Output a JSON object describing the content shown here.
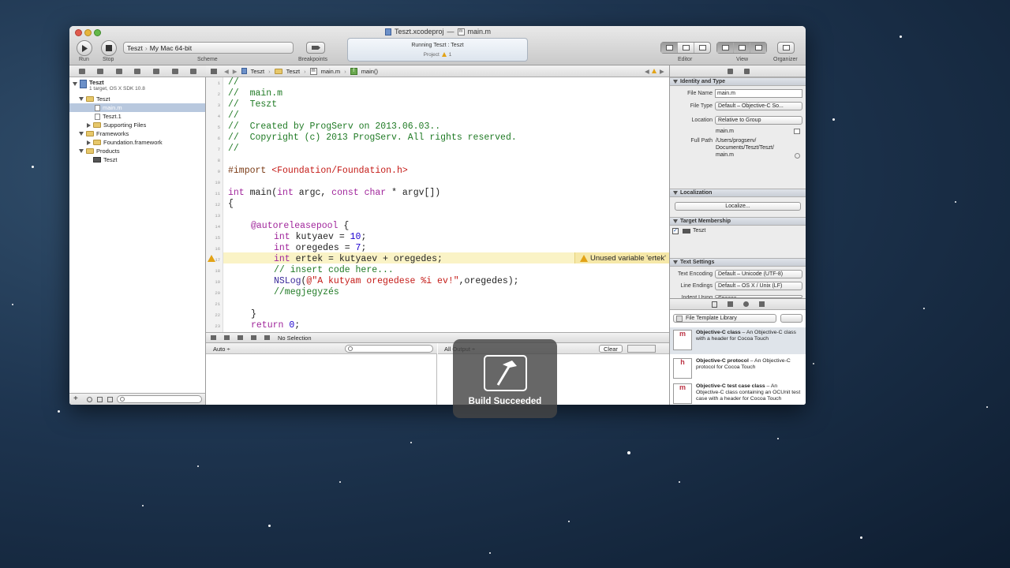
{
  "window": {
    "title_project": "Teszt.xcodeproj",
    "title_sep": "—",
    "title_file": "main.m"
  },
  "toolbar": {
    "run_label": "Run",
    "stop_label": "Stop",
    "scheme_target": "Teszt",
    "scheme_sep": "›",
    "scheme_dest": "My Mac 64-bit",
    "scheme_label": "Scheme",
    "breakpoints_label": "Breakpoints",
    "activity_status": "Running Teszt : Teszt",
    "activity_project_label": "Project",
    "activity_warning_count": "1",
    "editor_label": "Editor",
    "view_label": "View",
    "organizer_label": "Organizer"
  },
  "navigator": {
    "project_name": "Teszt",
    "project_sub": "1 target, OS X SDK 10.8",
    "items": [
      {
        "label": "Teszt",
        "kind": "folder"
      },
      {
        "label": "main.m",
        "kind": "file"
      },
      {
        "label": "Teszt.1",
        "kind": "file"
      },
      {
        "label": "Supporting Files",
        "kind": "folder"
      },
      {
        "label": "Frameworks",
        "kind": "folder"
      },
      {
        "label": "Foundation.framework",
        "kind": "folder"
      },
      {
        "label": "Products",
        "kind": "folder"
      },
      {
        "label": "Teszt",
        "kind": "product"
      }
    ]
  },
  "jumpbar": {
    "crumbs": [
      "Teszt",
      "Teszt",
      "main.m",
      "main()"
    ]
  },
  "editor": {
    "line_numbers": [
      "1",
      "2",
      "3",
      "4",
      "5",
      "6",
      "7",
      "8",
      "9",
      "10",
      "11",
      "12",
      "13",
      "14",
      "15",
      "16",
      "17",
      "18",
      "19",
      "20",
      "21",
      "22",
      "23"
    ],
    "lines": {
      "l1": "//",
      "l2": "//  main.m",
      "l3": "//  Teszt",
      "l4": "//",
      "l5": "//  Created by ProgServ on 2013.06.03..",
      "l6": "//  Copyright (c) 2013 ProgServ. All rights reserved.",
      "l7": "//",
      "l9a": "#import ",
      "l9b": "<Foundation/Foundation.h>",
      "l11a": "int",
      "l11b": " main(",
      "l11c": "int",
      "l11d": " argc, ",
      "l11e": "const char",
      "l11f": " * argv[])",
      "l12": "{",
      "l14a": "@autoreleasepool",
      "l14b": " {",
      "l15a": "int",
      "l15b": " kutyaev = ",
      "l15c": "10",
      "l15d": ";",
      "l16a": "int",
      "l16b": " oregedes = ",
      "l16c": "7",
      "l16d": ";",
      "l17a": "int",
      "l17b": " ertek = kutyaev + oregedes;",
      "l18": "// insert code here...",
      "l19a": "NSLog",
      "l19b": "(",
      "l19c": "@\"A kutyam oregedese %i ev!\"",
      "l19d": ",oregedes);",
      "l20": "//megjegyzés",
      "l22": "}",
      "l23a": "return",
      "l23b": " ",
      "l23c": "0",
      "l23d": ";"
    },
    "warning_text": "Unused variable 'ertek'"
  },
  "debug": {
    "selection_text": "No Selection",
    "auto_label": "Auto ÷",
    "all_output_label": "All Output ÷",
    "clear_label": "Clear"
  },
  "inspector": {
    "identity_header": "Identity and Type",
    "file_name_label": "File Name",
    "file_name_value": "main.m",
    "file_type_label": "File Type",
    "file_type_value": "Default – Objective-C So...",
    "location_label": "Location",
    "location_value": "Relative to Group",
    "location_file": "main.m",
    "full_path_label": "Full Path",
    "full_path_lines": [
      "/Users/progserv/",
      "Documents/Teszt/Teszt/",
      "main.m"
    ],
    "localization_header": "Localization",
    "localize_button": "Localize...",
    "target_header": "Target Membership",
    "target_name": "Teszt",
    "text_settings_header": "Text Settings",
    "text_encoding_label": "Text Encoding",
    "text_encoding_value": "Default – Unicode (UTF-8)",
    "line_endings_label": "Line Endings",
    "line_endings_value": "Default – OS X / Unix (LF)",
    "indent_label": "Indent Using",
    "indent_value": "Spaces",
    "library_popup": "File Template Library",
    "templates": [
      {
        "icon": "m",
        "title": "Objective-C class",
        "desc": " – An Objective-C class with a header for Cocoa Touch"
      },
      {
        "icon": "h",
        "title": "Objective-C protocol",
        "desc": " – An Objective-C protocol for Cocoa Touch"
      },
      {
        "icon": "m",
        "title": "Objective-C test case class",
        "desc": " – An Objective-C class containing an OCUnit test case with a header for Cocoa Touch"
      }
    ]
  },
  "hud": {
    "text": "Build Succeeded"
  },
  "colors": {
    "comment": "#1f7a24",
    "keyword": "#a0259b",
    "string": "#c41a16",
    "number": "#1c00cf",
    "warning_bg": "#faf3c6",
    "selection": "#b8c8de"
  }
}
